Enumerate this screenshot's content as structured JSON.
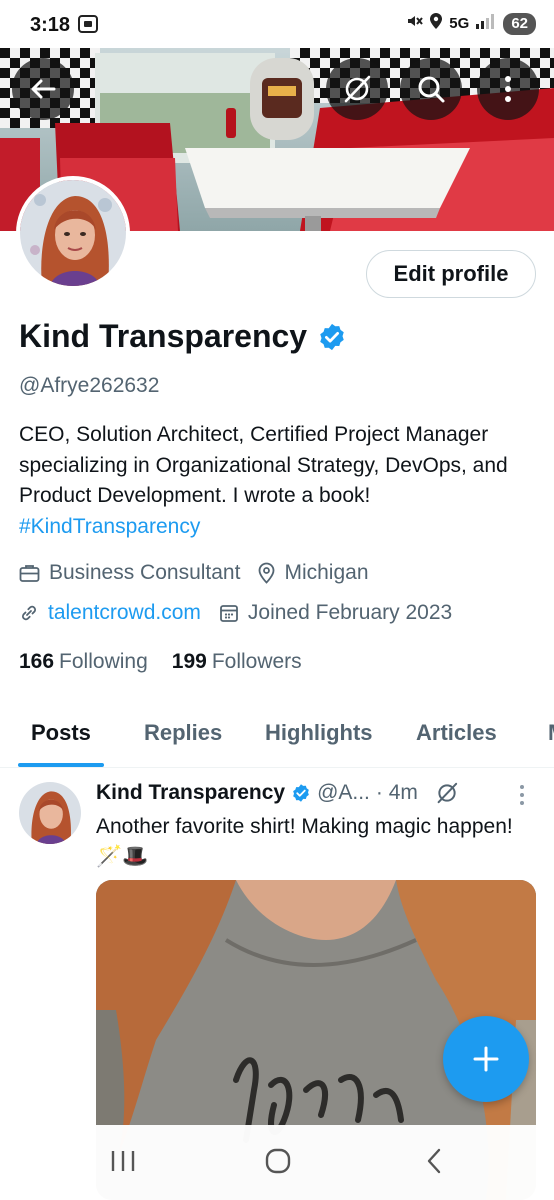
{
  "status_bar": {
    "time": "3:18",
    "network": "5G",
    "battery": "62"
  },
  "header": {
    "icons": [
      "back-arrow-icon",
      "grok-icon",
      "search-icon",
      "more-vertical-icon"
    ]
  },
  "profile": {
    "display_name": "Kind Transparency",
    "verified": true,
    "handle": "@Afrye262632",
    "edit_button_label": "Edit profile",
    "bio_text": "CEO, Solution Architect, Certified Project Manager specializing in Organizational Strategy, DevOps, and Product Development.  I wrote a book! ",
    "bio_hashtag": "#KindTransparency",
    "category": "Business Consultant",
    "location": "Michigan",
    "website": "talentcrowd.com",
    "joined": "Joined February 2023",
    "following_count": "166",
    "following_label": "Following",
    "followers_count": "199",
    "followers_label": "Followers"
  },
  "tabs": [
    {
      "label": "Posts",
      "active": true
    },
    {
      "label": "Replies",
      "active": false
    },
    {
      "label": "Highlights",
      "active": false
    },
    {
      "label": "Articles",
      "active": false
    },
    {
      "label": "M",
      "active": false
    }
  ],
  "post": {
    "author_name": "Kind Transparency",
    "author_handle": "@A...",
    "time": "· 4m",
    "text": "Another favorite shirt! Making magic happen! 🪄🎩"
  },
  "colors": {
    "accent": "#1d9bf0",
    "text_primary": "#0f1419",
    "text_secondary": "#536471"
  }
}
